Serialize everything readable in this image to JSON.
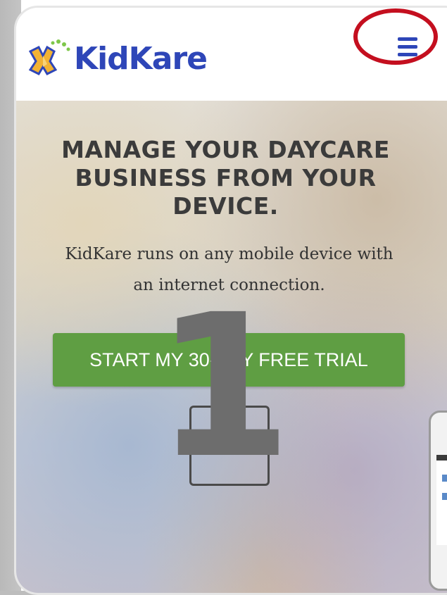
{
  "header": {
    "logo_text": "KidKare",
    "menu_icon": "hamburger-menu-icon"
  },
  "hero": {
    "headline_lines": [
      "MANAGE YOUR DAYCARE",
      "BUSINESS FROM YOUR",
      "DEVICE."
    ],
    "subtext_lines": [
      "KidKare runs on any mobile device with",
      "an internet connection."
    ],
    "cta_label": "START MY 30-DAY FREE TRIAL"
  },
  "annotation": {
    "step_number": "1",
    "highlight_color": "#c40f1f"
  },
  "colors": {
    "brand_blue": "#2e46b8",
    "cta_green": "#5f9e43"
  }
}
